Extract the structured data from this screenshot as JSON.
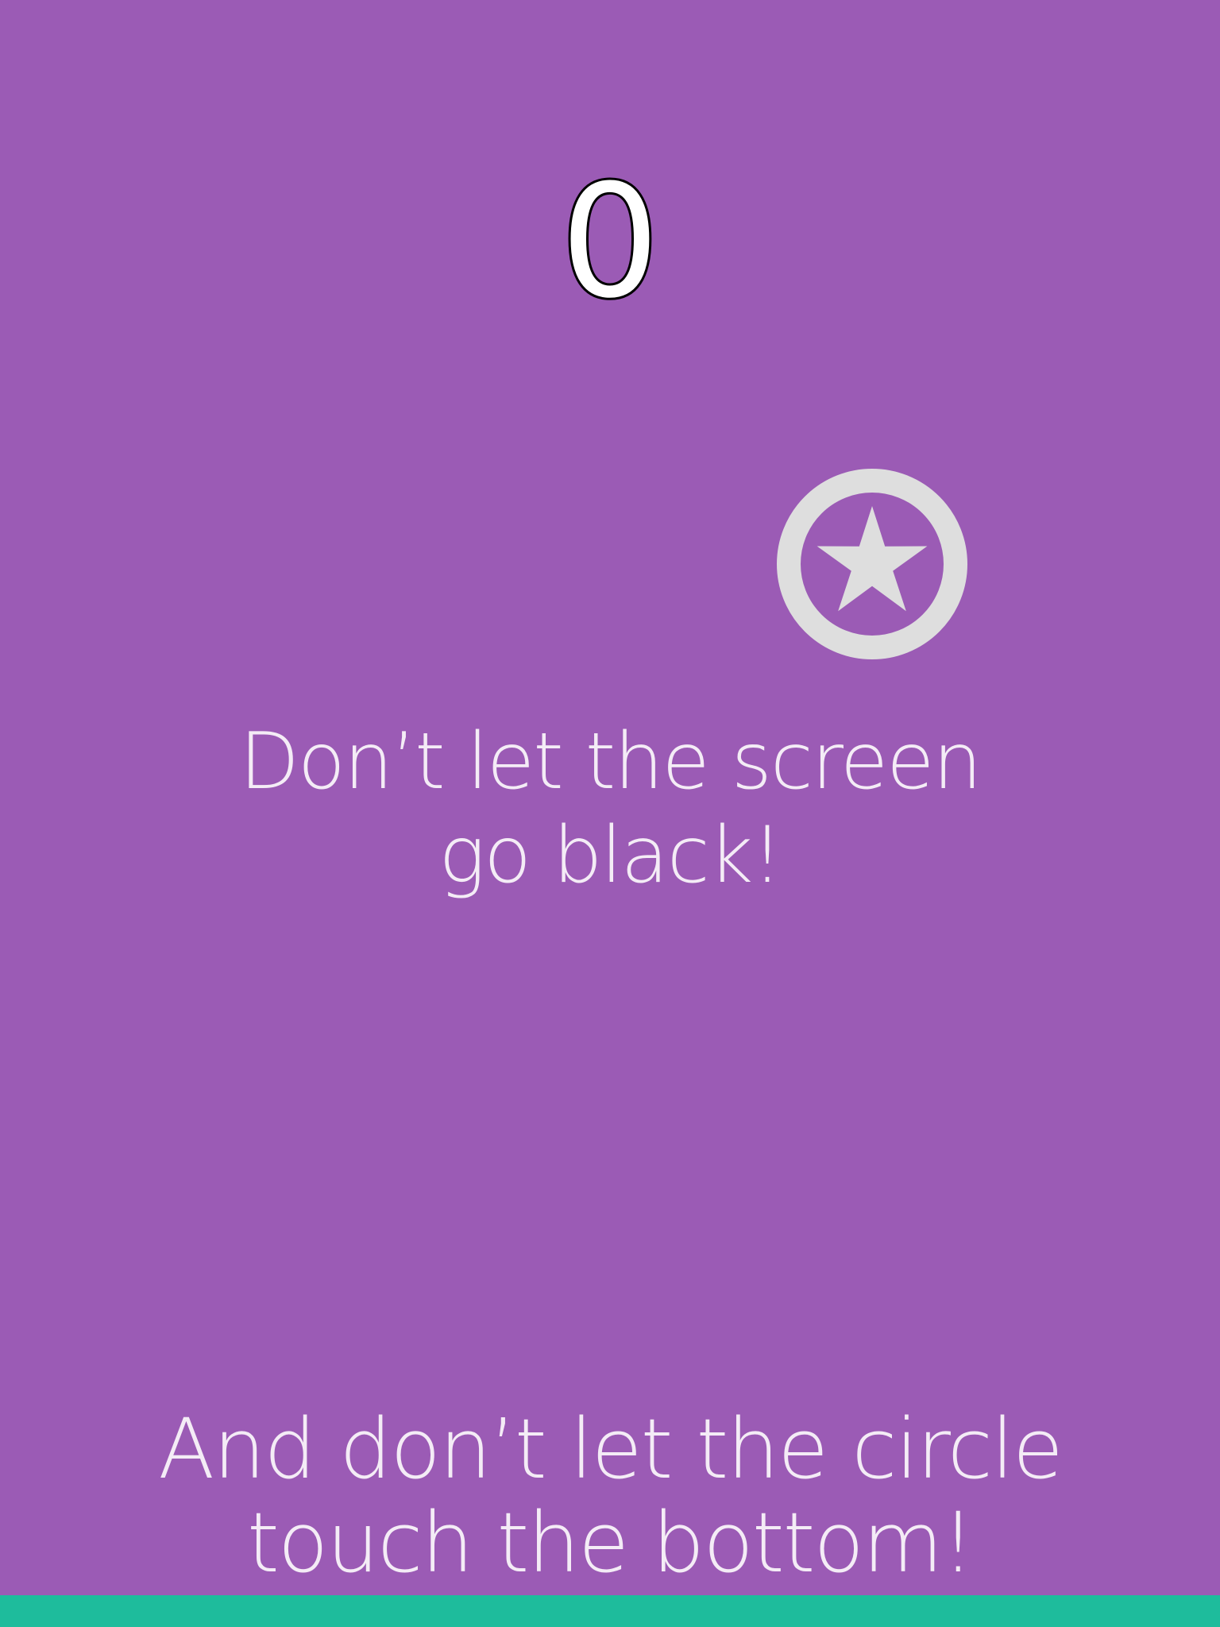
{
  "game": {
    "score": "0",
    "instruction_top": "Don’t let the screen\ngo black!",
    "instruction_bottom": "And don’t let the circle\ntouch the bottom!",
    "ball_icon": "star-in-circle"
  },
  "colors": {
    "background": "#9b5bb5",
    "text": "#f4ecf6",
    "ball": "#dedede",
    "ground": "#1ebc9c",
    "score_fill": "#ffffff",
    "score_outline": "#000000"
  }
}
